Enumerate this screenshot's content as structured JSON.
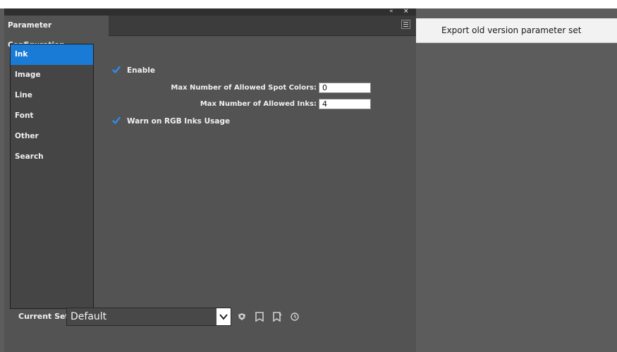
{
  "panel": {
    "tab_label": "Parameter Configuration",
    "controls": {
      "collapse_glyph": "«",
      "close_glyph": "×"
    }
  },
  "sidebar": {
    "items": [
      {
        "label": "Ink",
        "active": true
      },
      {
        "label": "Image",
        "active": false
      },
      {
        "label": "Line",
        "active": false
      },
      {
        "label": "Font",
        "active": false
      },
      {
        "label": "Other",
        "active": false
      },
      {
        "label": "Search",
        "active": false
      }
    ]
  },
  "ink": {
    "enable": {
      "label": "Enable",
      "checked": true
    },
    "max_spot_colors": {
      "label": "Max Number of Allowed Spot Colors:",
      "value": "0"
    },
    "max_inks": {
      "label": "Max Number of Allowed Inks:",
      "value": "4"
    },
    "warn_rgb": {
      "label": "Warn on RGB Inks Usage",
      "checked": true
    }
  },
  "footer": {
    "current_set_label": "Current Set:",
    "current_set_value": "Default",
    "icons": [
      "new-set-icon",
      "save-set-icon",
      "save-as-set-icon",
      "history-icon"
    ]
  },
  "menu": {
    "items": [
      {
        "label": "Export old version parameter set"
      }
    ]
  },
  "colors": {
    "accent": "#1a7bd6",
    "panel_bg": "#535353",
    "check_blue": "#2d8ceb"
  }
}
